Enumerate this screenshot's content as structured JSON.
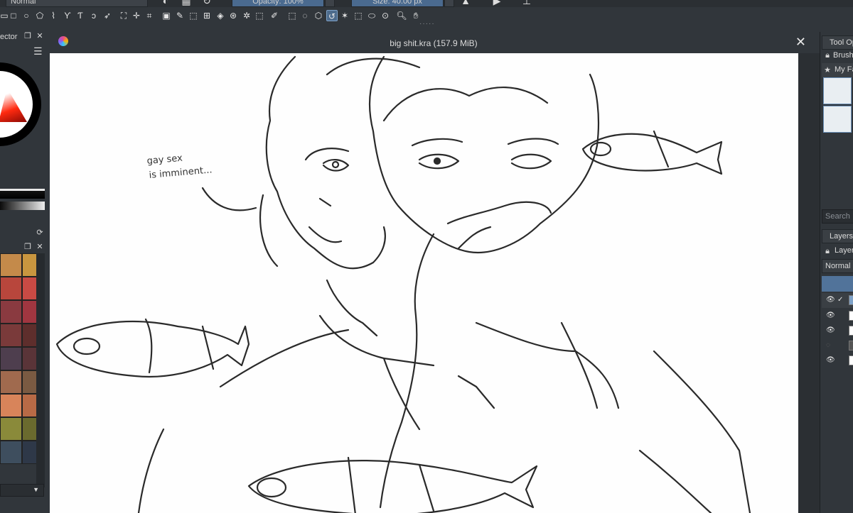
{
  "top_toolbar": {
    "blend_mode": "Normal",
    "opacity": "Opacity: 100%",
    "size": "Size: 40.00 px"
  },
  "document": {
    "title": "big shit.kra (157.9 MiB)"
  },
  "left_dock": {
    "title": "ector"
  },
  "canvas": {
    "caption_line1": "gay sex",
    "caption_line2": "is imminent..."
  },
  "right_dock": {
    "tool_options_tab": "Tool Op",
    "brushes_tab": "Brush",
    "favorites_row": "My Fa",
    "search_placeholder": "Search",
    "layers_tab": "Layers",
    "layers_row": "Layer",
    "blend_mode": "Normal"
  },
  "palette_colors": [
    "#c48a4a",
    "#c9963f",
    "#b8463c",
    "#c94a44",
    "#8a3a40",
    "#a03640",
    "#7a3a3a",
    "#5e2e2c",
    "#4e3e4e",
    "#5a3438",
    "#a06a4e",
    "#7a5a42",
    "#d8845a",
    "#b86a46",
    "#8a8a3a",
    "#6a6a2e",
    "#3e4e5e",
    "#2e3848"
  ]
}
